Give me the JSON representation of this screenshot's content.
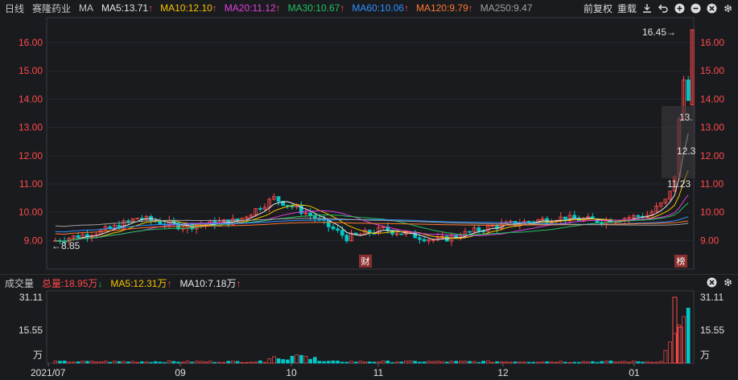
{
  "header": {
    "period": "日线",
    "stock_name": "赛隆药业",
    "indicator": "MA",
    "ma": [
      {
        "label": "MA5:13.71",
        "color": "#e8e8e8"
      },
      {
        "label": "MA10:12.10",
        "color": "#f5c400"
      },
      {
        "label": "MA20:11.12",
        "color": "#e040e0"
      },
      {
        "label": "MA30:10.67",
        "color": "#20c060"
      },
      {
        "label": "MA60:10.06",
        "color": "#3090ff"
      },
      {
        "label": "MA120:9.79",
        "color": "#ff7a30"
      },
      {
        "label": "MA250:9.47",
        "color": "#a0a0a0"
      }
    ],
    "arrow": "↑",
    "tools": {
      "fq": "前复权",
      "overlay": "重载"
    }
  },
  "price_axis": [
    "16.00",
    "15.00",
    "14.00",
    "13.00",
    "12.00",
    "11.00",
    "10.00",
    "9.00"
  ],
  "annotations": {
    "high": "16.45→",
    "low": "←8.85",
    "ma5_end": "13.",
    "ma10_end": "12.3",
    "ma20_end": "11.23",
    "marker_finance": "财",
    "marker_list": "榜"
  },
  "volume": {
    "title": "成交量",
    "total": "总量:18.95万",
    "total_arrow": "↓",
    "ma5": "MA5:12.31万",
    "ma10": "MA10:7.18万",
    "ma_arrow": "↑",
    "axis": [
      "31.11",
      "15.55"
    ],
    "unit": "万"
  },
  "x_axis": [
    "2021/07",
    "09",
    "10",
    "11",
    "12",
    "01"
  ],
  "colors": {
    "up": "#ff4a4a",
    "down": "#00c8c8",
    "bg": "#1a1b1f",
    "grid": "#2a2b30"
  }
}
